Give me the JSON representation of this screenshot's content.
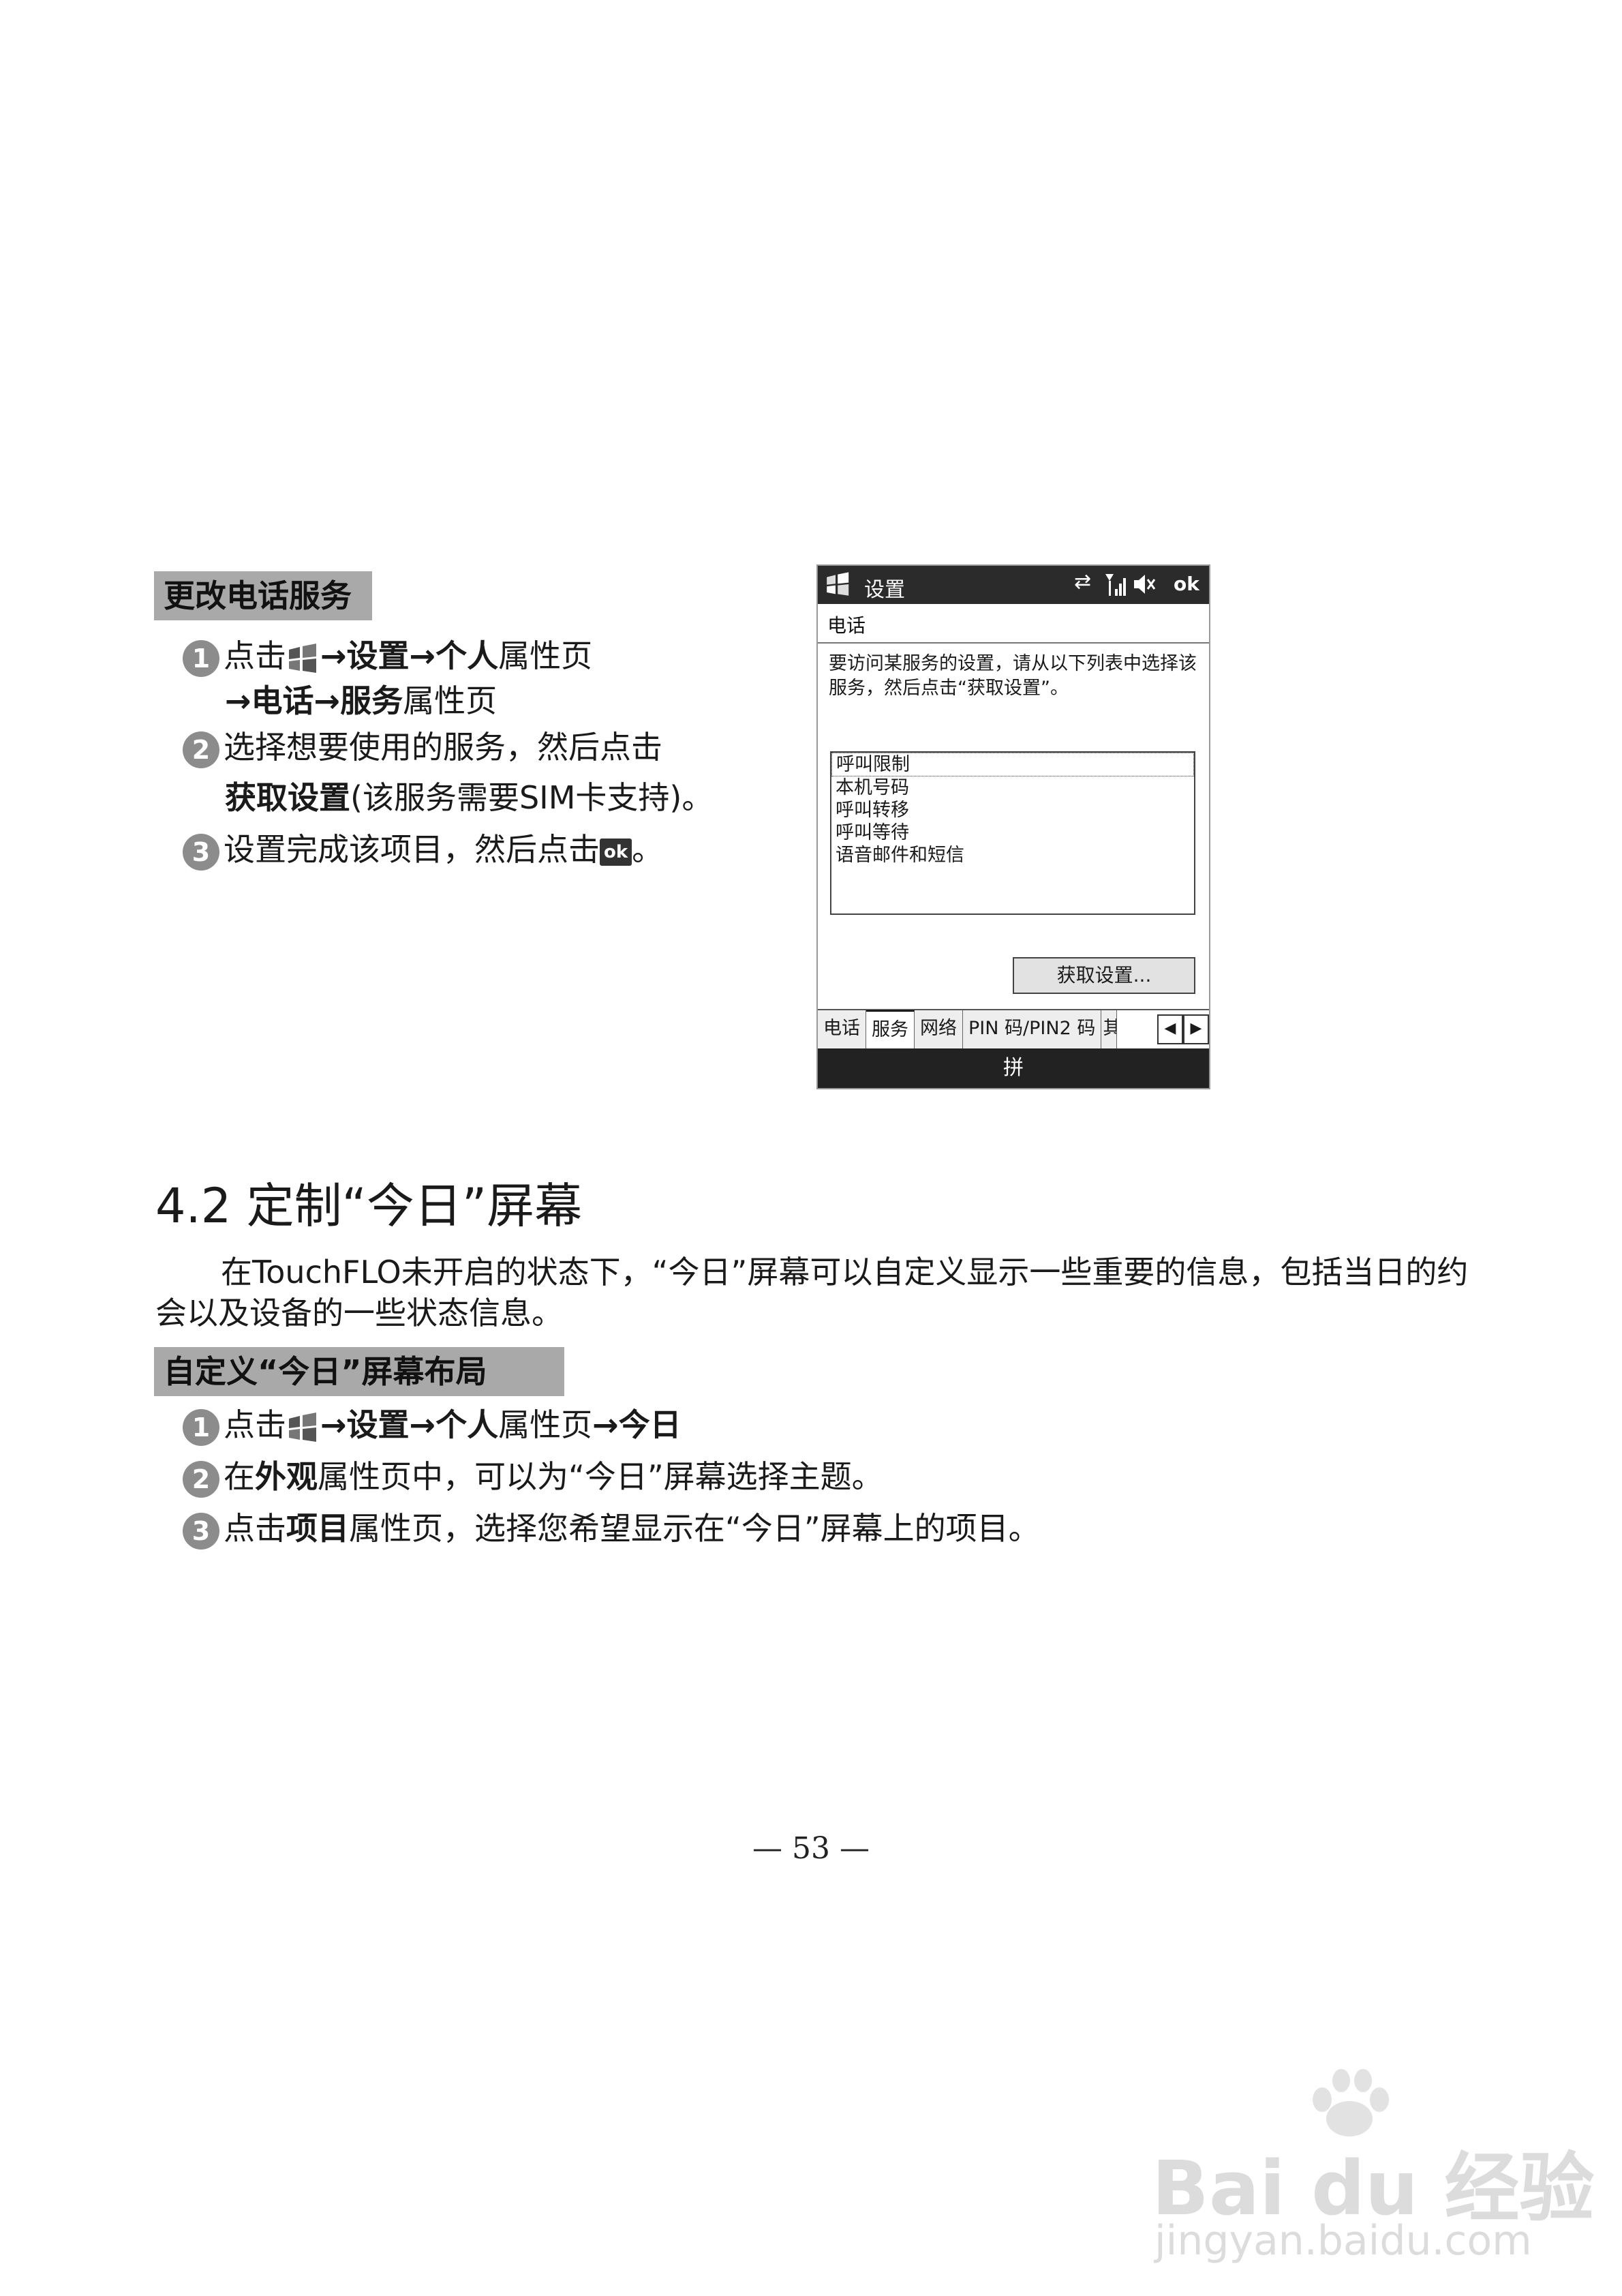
{
  "section1": {
    "header": "更改电话服务",
    "steps": [
      {
        "num": "1",
        "line1_pre": "点击",
        "bold1": "设置",
        "bold2": "个人",
        "line1_post": "属性页",
        "bold3": "电话",
        "bold4": "服务",
        "line2_post": "属性页"
      },
      {
        "num": "2",
        "line1": "选择想要使用的服务，然后点击",
        "bold": "获取设置",
        "line2_post": "(该服务需要SIM卡支持)。"
      },
      {
        "num": "3",
        "pre": "设置完成该项目，然后点击",
        "ok": "ok",
        "post": "。"
      }
    ]
  },
  "phone": {
    "title": "设置",
    "ok": "ok",
    "subtitle": "电话",
    "description": "要访问某服务的设置，请从以下列表中选择该服务，然后点击“获取设置”。",
    "services": [
      "呼叫限制",
      "本机号码",
      "呼叫转移",
      "呼叫等待",
      "语音邮件和短信"
    ],
    "button": "获取设置...",
    "tabs": [
      "电话",
      "服务",
      "网络",
      "PIN 码/PIN2 码",
      "其"
    ],
    "input_method": "拼"
  },
  "section2": {
    "heading": "4.2  定制“今日”屏幕",
    "paragraph": "在TouchFLO未开启的状态下，“今日”屏幕可以自定义显示一些重要的信息，包括当日的约会以及设备的一些状态信息。",
    "header": "自定义“今日”屏幕布局",
    "step1": {
      "num": "1",
      "pre": "点击",
      "bold1": "设置",
      "bold2": "个人",
      "mid": "属性页",
      "bold3": "今日"
    },
    "step2": {
      "num": "2",
      "pre": "在",
      "bold": "外观",
      "post": "属性页中，可以为“今日”屏幕选择主题。"
    },
    "step3": {
      "num": "3",
      "pre": "点击",
      "bold": "项目",
      "post": "属性页，选择您希望显示在“今日”屏幕上的项目。"
    }
  },
  "page_number": "— 53 —",
  "watermark": {
    "brand": "Bai du 经验",
    "url": "jingyan.baidu.com"
  }
}
